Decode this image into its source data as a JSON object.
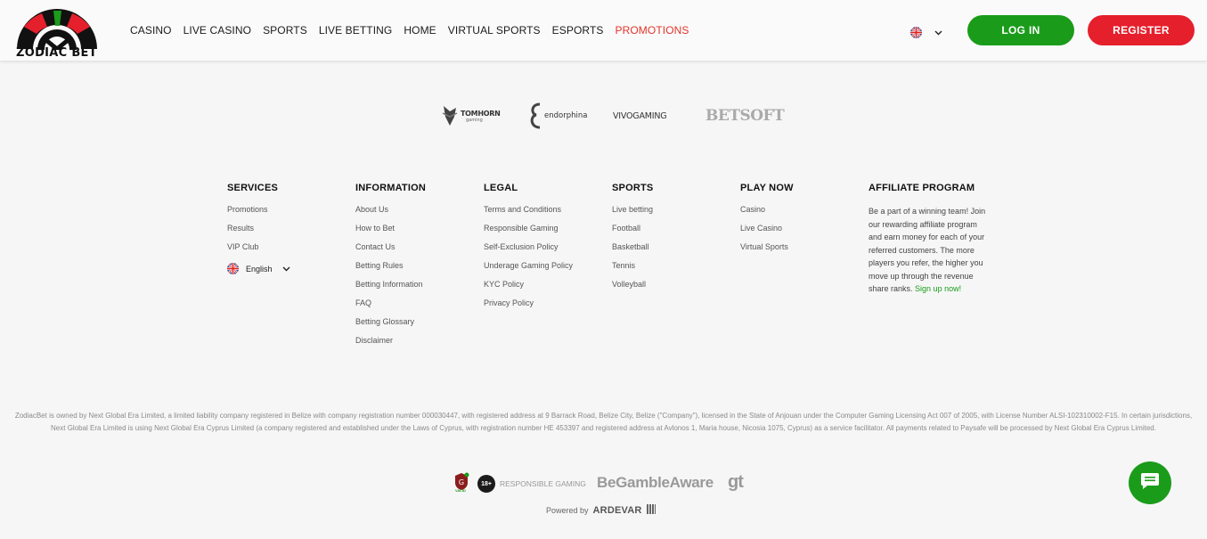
{
  "brand": {
    "name": "ZODIAC BET"
  },
  "nav": [
    {
      "label": "CASINO"
    },
    {
      "label": "LIVE CASINO"
    },
    {
      "label": "SPORTS"
    },
    {
      "label": "LIVE BETTING"
    },
    {
      "label": "HOME"
    },
    {
      "label": "VIRTUAL SPORTS"
    },
    {
      "label": "ESPORTS"
    },
    {
      "label": "PROMOTIONS",
      "active": true
    }
  ],
  "header": {
    "login_label": "LOG IN",
    "register_label": "REGISTER"
  },
  "providers": [
    "TOMHORN",
    "endorphina",
    "VIVOGAMING",
    "BETSOFT"
  ],
  "provider_sub": {
    "tomhorn": "gaming"
  },
  "footer": {
    "services": {
      "title": "SERVICES",
      "links": [
        "Promotions",
        "Results",
        "VIP Club"
      ],
      "language": "English"
    },
    "information": {
      "title": "INFORMATION",
      "links": [
        "About Us",
        "How to Bet",
        "Contact Us",
        "Betting Rules",
        "Betting Information",
        "FAQ",
        "Betting Glossary",
        "Disclaimer"
      ]
    },
    "legal": {
      "title": "LEGAL",
      "links": [
        "Terms and Conditions",
        "Responsible Gaming",
        "Self-Exclusion Policy",
        "Underage Gaming Policy",
        "KYC Policy",
        "Privacy Policy"
      ]
    },
    "sports": {
      "title": "SPORTS",
      "links": [
        "Live betting",
        "Football",
        "Basketball",
        "Tennis",
        "Volleyball"
      ]
    },
    "play_now": {
      "title": "PLAY NOW",
      "links": [
        "Casino",
        "Live Casino",
        "Virtual Sports"
      ]
    },
    "affiliate": {
      "title": "AFFILIATE PROGRAM",
      "text": "Be a part of a winning team! Join our rewarding affiliate program and earn money for each of your referred customers. The more players you refer, the higher you move up through the revenue share ranks.",
      "link": "Sign up now!"
    }
  },
  "legal_text": "ZodiacBet is owned by Next Global Era Limited, a limited liability company registered in Belize with company registration number 000030447, with registered address at 9 Barrack Road, Belize City, Belize (\"Company\"), licensed in the State of Anjouan under the Computer Gaming Licensing Act 007 of 2005, with License Number ALSI-102310002-F15. In certain jurisdictions, Next Global Era Limited is using Next Global Era Cyprus Limited (a company registered and established under the Laws of Cyprus, with registration number HE 453397 and registered address at Avlonos 1, Maria house, Nicosia 1075, Cyprus) as a service facilitator. All payments related to Paysafe will be processed by Next Global Era Cyprus Limited.",
  "badges": {
    "valid": "VALID",
    "age": "18+",
    "responsible": "RESPONSIBLE GAMING",
    "begamble": "BeGambleAware",
    "gt": "gt"
  },
  "powered": {
    "label": "Powered by",
    "brand": "ARDEVAR"
  },
  "colors": {
    "green": "#1a9c1a",
    "red": "#e51f2c",
    "promo": "#e5342a"
  }
}
